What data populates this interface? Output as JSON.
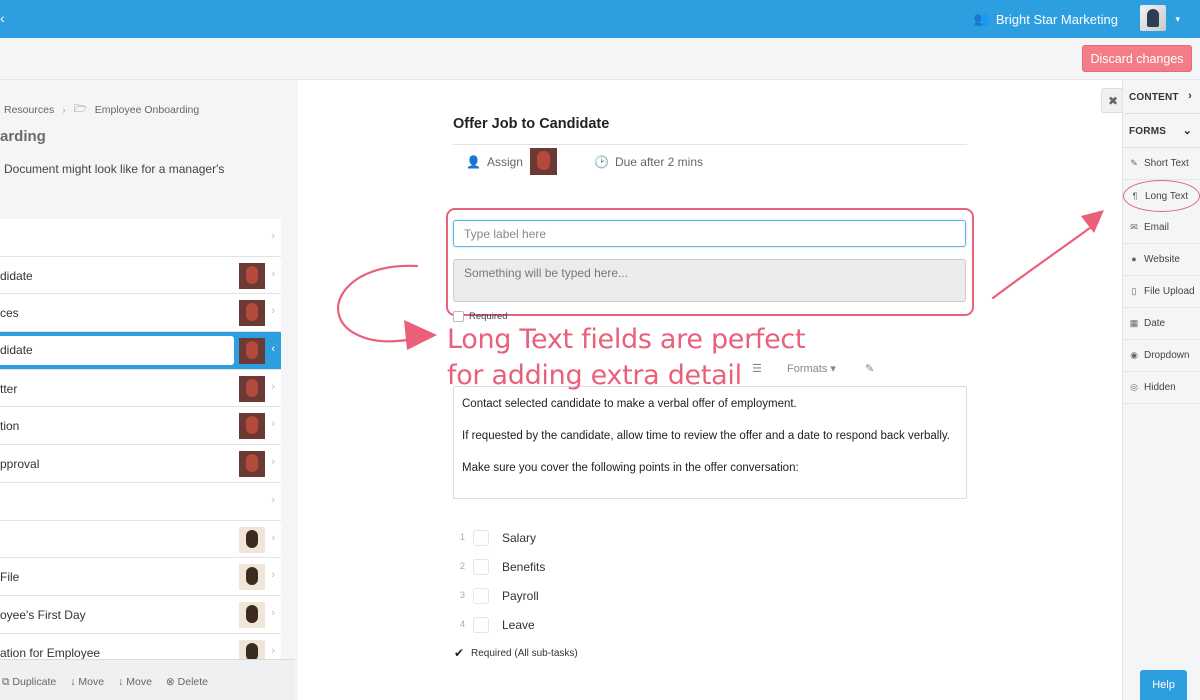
{
  "topbar": {
    "back_icon": "chevron-left-icon",
    "org_icon": "users-icon",
    "org_name": "Bright Star Marketing",
    "user_caret": "▾"
  },
  "header": {
    "discard_label": "Discard changes"
  },
  "left": {
    "breadcrumbs": [
      "Resources",
      "Employee Onboarding"
    ],
    "title": "arding",
    "description": "Document might look like for a manager's",
    "tasks": [
      {
        "label": "",
        "avatar": false
      },
      {
        "label": "didate",
        "avatar": true,
        "avatar_style": "red"
      },
      {
        "label": "ces",
        "avatar": true,
        "avatar_style": "red"
      },
      {
        "label": "didate",
        "avatar": true,
        "avatar_style": "red",
        "active": true
      },
      {
        "label": "tter",
        "avatar": true,
        "avatar_style": "red"
      },
      {
        "label": "tion",
        "avatar": true,
        "avatar_style": "red"
      },
      {
        "label": "pproval",
        "avatar": true,
        "avatar_style": "red"
      },
      {
        "label": "",
        "avatar": false
      },
      {
        "label": "",
        "avatar": true,
        "avatar_style": "light"
      },
      {
        "label": "File",
        "avatar": true,
        "avatar_style": "light"
      },
      {
        "label": "oyee's First Day",
        "avatar": true,
        "avatar_style": "light"
      },
      {
        "label": "ation for Employee",
        "avatar": true,
        "avatar_style": "light"
      }
    ],
    "footer_actions": [
      "Duplicate",
      "Move",
      "Move",
      "Delete"
    ]
  },
  "task": {
    "title": "Offer Job to Candidate",
    "assign_label": "Assign",
    "due_label": "Due after 2 mins"
  },
  "form_field": {
    "label_placeholder": "Type label here",
    "value_placeholder": "Something will be typed here...",
    "required_label": "Required"
  },
  "editor": {
    "formats_label": "Formats",
    "paragraphs": [
      "Contact selected candidate to make a verbal offer of employment.",
      "If requested by the candidate, allow time to review the offer and a date to respond back verbally.",
      "Make sure you cover the following points in the offer conversation:"
    ]
  },
  "subtasks": [
    {
      "num": "1",
      "label": "Salary"
    },
    {
      "num": "2",
      "label": "Benefits"
    },
    {
      "num": "3",
      "label": "Payroll"
    },
    {
      "num": "4",
      "label": "Leave"
    }
  ],
  "required_all_label": "Required (All sub-tasks)",
  "annotation": {
    "line1": "Long Text fields are perfect",
    "line2": "for adding extra detail",
    "color": "#ea5f7a"
  },
  "palette": {
    "close_label": "✖",
    "content_label": "CONTENT",
    "forms_label": "FORMS",
    "items": [
      {
        "label": "Short Text",
        "icon": "edit-icon"
      },
      {
        "label": "Long Text",
        "icon": "paragraph-icon"
      },
      {
        "label": "Email",
        "icon": "envelope-icon"
      },
      {
        "label": "Website",
        "icon": "globe-icon"
      },
      {
        "label": "File Upload",
        "icon": "file-icon"
      },
      {
        "label": "Date",
        "icon": "calendar-icon"
      },
      {
        "label": "Dropdown",
        "icon": "dropdown-icon"
      },
      {
        "label": "Hidden",
        "icon": "eye-slash-icon"
      }
    ]
  },
  "help_label": "Help",
  "colors": {
    "topbar": "#2d9fe0",
    "discard": "#f27d86",
    "annotation": "#ea5f7a",
    "active_task": "#2d9fe0"
  }
}
